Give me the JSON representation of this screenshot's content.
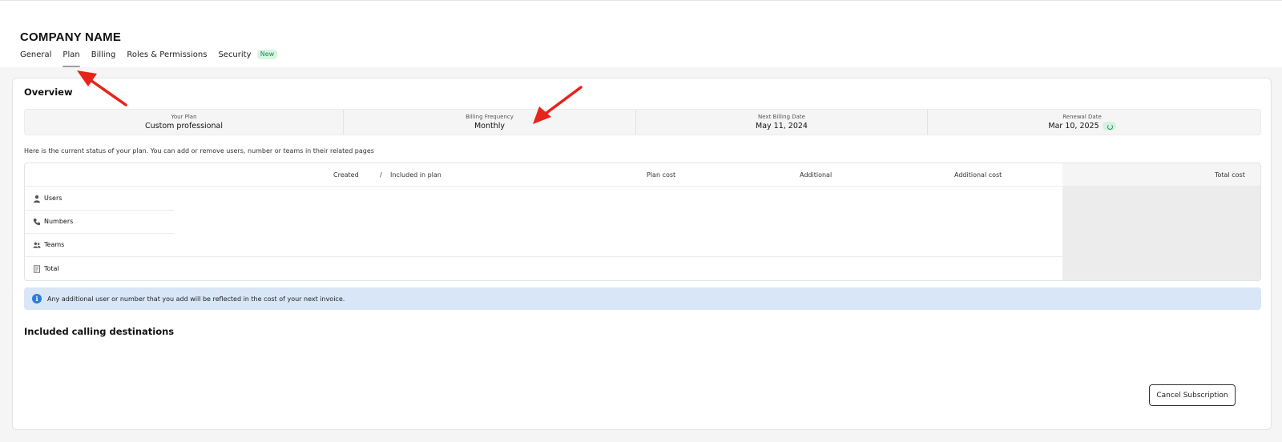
{
  "header": {
    "company_name": "COMPANY NAME",
    "tabs": [
      {
        "label": "General"
      },
      {
        "label": "Plan",
        "active": true
      },
      {
        "label": "Billing"
      },
      {
        "label": "Roles & Permissions"
      },
      {
        "label": "Security",
        "badge": "New"
      }
    ]
  },
  "overview": {
    "title": "Overview",
    "stats": [
      {
        "label": "Your Plan",
        "value": "Custom professional"
      },
      {
        "label": "Billing Frequency",
        "value": "Monthly"
      },
      {
        "label": "Next Billing Date",
        "value": "May 11, 2024"
      },
      {
        "label": "Renewal Date",
        "value": "Mar 10, 2025"
      }
    ],
    "status_text": "Here is the current status of your plan. You can add or remove users, number or teams in their related pages",
    "table": {
      "headers": {
        "created": "Created",
        "separator": "/",
        "included": "Included in plan",
        "plan_cost": "Plan cost",
        "additional": "Additional",
        "additional_cost": "Additional cost",
        "total_cost": "Total cost"
      },
      "rows": [
        {
          "label": "Users",
          "icon": "user-icon"
        },
        {
          "label": "Numbers",
          "icon": "phone-icon"
        },
        {
          "label": "Teams",
          "icon": "team-icon"
        },
        {
          "label": "Total",
          "icon": "invoice-icon"
        }
      ]
    },
    "info_message": "Any additional user or number that you add will be reflected in the cost of your next invoice."
  },
  "calling_destinations": {
    "title": "Included calling destinations"
  },
  "actions": {
    "cancel_label": "Cancel Subscription"
  },
  "colors": {
    "annotation_arrow": "#e8231a",
    "info_bg": "#d8e6f7",
    "info_icon": "#2d7be0",
    "badge_bg": "#d6f5e3"
  }
}
